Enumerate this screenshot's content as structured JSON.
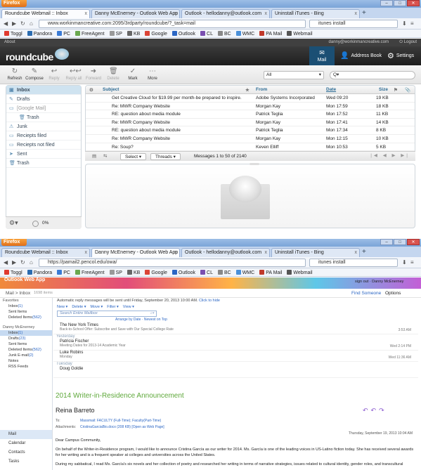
{
  "top_window": {
    "firefox_label": "Firefox",
    "tabs": [
      {
        "label": "Roundcube Webmail :: Inbox"
      },
      {
        "label": "Danny McEnerney - Outlook Web App"
      },
      {
        "label": "Outlook - hellodanny@outlook.com"
      },
      {
        "label": "Uninstall iTunes - Bing"
      }
    ],
    "url": "www.workinmancreative.com:2095/3rdparty/roundcube/?_task=mail",
    "search": "itunes install",
    "bookmarks": [
      "Toggl",
      "Pandora",
      "PC",
      "FreeAgent",
      "SP",
      "KB",
      "Google",
      "Outlook",
      "CL",
      "BC",
      "WMC",
      "PA Mail",
      "Webmail"
    ]
  },
  "roundcube": {
    "about": "About",
    "user": "danny@workinmancreative.com",
    "logout": "Logout",
    "logo": "roundcube",
    "nav": {
      "mail": "Mail",
      "address_book": "Address Book",
      "settings": "Settings"
    },
    "toolbar": [
      "Refresh",
      "Compose",
      "Reply",
      "Reply all",
      "Forward",
      "Delete",
      "Mark",
      "More"
    ],
    "filter": "All",
    "search_placeholder": "Q▾",
    "folders": [
      {
        "label": "Inbox",
        "icon": "inbox-icon",
        "sel": true
      },
      {
        "label": "Drafts",
        "icon": "drafts-icon"
      },
      {
        "label": "[Google Mail]",
        "icon": "folder-icon",
        "muted": true
      },
      {
        "label": "Trash",
        "icon": "trash-icon",
        "indent": true
      },
      {
        "label": "Junk",
        "icon": "junk-icon"
      },
      {
        "label": "Reciepts filed",
        "icon": "folder-icon"
      },
      {
        "label": "Reciepts not filed",
        "icon": "folder-icon"
      },
      {
        "label": "Sent",
        "icon": "sent-icon"
      },
      {
        "label": "Trash",
        "icon": "trash-icon"
      }
    ],
    "quota": "0%",
    "columns": {
      "subject": "Subject",
      "from": "From",
      "date": "Date",
      "size": "Size"
    },
    "messages": [
      {
        "subject": "Get Creative Cloud for $19.99 per month-be prepared to inspire.",
        "from": "Adobe Systems Incorporated",
        "date": "Wed 09:20",
        "size": "19 KB"
      },
      {
        "subject": "Re: MWR Company Website",
        "from": "Morgan Kay",
        "date": "Mon 17:59",
        "size": "18 KB"
      },
      {
        "subject": "RE: question about media module",
        "from": "Patrick Teglia",
        "date": "Mon 17:52",
        "size": "11 KB"
      },
      {
        "subject": "Re: MWR Company Website",
        "from": "Morgan Kay",
        "date": "Mon 17:41",
        "size": "14 KB"
      },
      {
        "subject": "RE: question about media module",
        "from": "Patrick Teglia",
        "date": "Mon 17:34",
        "size": "8 KB"
      },
      {
        "subject": "Re: MWR Company Website",
        "from": "Morgan Kay",
        "date": "Mon 12:15",
        "size": "10 KB"
      },
      {
        "subject": "Re: Soup?",
        "from": "Keven Elliff",
        "date": "Mon 10:53",
        "size": "5 KB"
      }
    ],
    "footer": {
      "select": "Select",
      "threads": "Threads",
      "count": "Messages 1 to 50 of 2140"
    }
  },
  "bottom_window": {
    "firefox_label": "Firefox",
    "tabs": [
      {
        "label": "Roundcube Webmail :: Inbox"
      },
      {
        "label": "Danny McEnerney - Outlook Web App"
      },
      {
        "label": "Outlook - hellodanny@outlook.com"
      },
      {
        "label": "Uninstall iTunes - Bing"
      }
    ],
    "url": "https://pamail2.pencol.edu/owa/",
    "search": "itunes install",
    "bookmarks": [
      "Toggl",
      "Pandora",
      "PC",
      "FreeAgent",
      "SP",
      "KB",
      "Google",
      "Outlook",
      "CL",
      "BC",
      "WMC",
      "PA Mail",
      "Webmail"
    ]
  },
  "owa": {
    "title": "Outlook Web App",
    "signout": "sign out",
    "user": "Danny McEnerney",
    "breadcrumb": "Mail > Inbox",
    "item_count": "1698 items",
    "find_someone": "Find Someone",
    "options": "Options",
    "auto_reply": "Automatic reply messages will be sent until Friday, September 20, 2013 10:00 AM.",
    "hide": "Click to hide",
    "actions": [
      "New",
      "Delete",
      "Move",
      "Filter",
      "View"
    ],
    "search_placeholder": "Search Entire Mailbox",
    "arrange": "Arrange by Date",
    "newest": "Newest on Top",
    "favorites_label": "Favorites",
    "favorites": [
      {
        "label": "Inbox",
        "count": "(1)"
      },
      {
        "label": "Sent Items",
        "count": ""
      },
      {
        "label": "Deleted Items",
        "count": "(562)"
      }
    ],
    "account": "Danny McEnerney",
    "folders": [
      {
        "label": "Inbox",
        "count": "(1)",
        "sel": true
      },
      {
        "label": "Drafts",
        "count": "(23)"
      },
      {
        "label": "Sent Items",
        "count": ""
      },
      {
        "label": "Deleted Items",
        "count": "(562)"
      },
      {
        "label": "Junk E-mail",
        "count": "(2)"
      },
      {
        "label": "Notes",
        "count": ""
      },
      {
        "label": "RSS Feeds",
        "count": ""
      }
    ],
    "nav": [
      "Mail",
      "Calendar",
      "Contacts",
      "Tasks"
    ],
    "messages": [
      {
        "from": "The New York Times",
        "preview": "Back-to-School Offer: Subscribe and Save with Our Special College Rate",
        "time": "3:53 AM"
      },
      {
        "group": "Yesterday"
      },
      {
        "from": "Patricia Fischer",
        "preview": "Meeting Dates for 2013-14 Academic Year",
        "time": "Wed 2:14 PM"
      },
      {
        "from": "Luke Robins",
        "preview": "Monday",
        "time": "Wed 11:36 AM"
      },
      {
        "group": "Tuesday"
      },
      {
        "from": "Doug Goldie",
        "preview": "",
        "time": ""
      }
    ],
    "read": {
      "subject": "2014 Writer-in-Residence Announcement",
      "sender": "Reina Barreto",
      "to_label": "To:",
      "to": "Massmail: FACULTY (Full-Time); Faculty(Part-Time)",
      "att_label": "Attachments:",
      "attachment": "CristinaGarciaBio.docx (208 KB) [Open as Web Page]",
      "date": "Thursday, September 19, 2013 10:04 AM",
      "greeting": "Dear Campus Community,",
      "p1": "On behalf of the Writer-in-Residence program, I would like to announce Cristina García as our writer for 2014. Ms. García is one of the leading voices in US-Latino fiction today. She has received several awards for her writing and is a frequent speaker at colleges and universities across the United States.",
      "p2": "During my sabbatical, I read Ms. García's six novels and her collection of poetry and researched her writing in terms of narrative strategies, issues related to cultural identity, gender roles, and transcultural"
    }
  }
}
